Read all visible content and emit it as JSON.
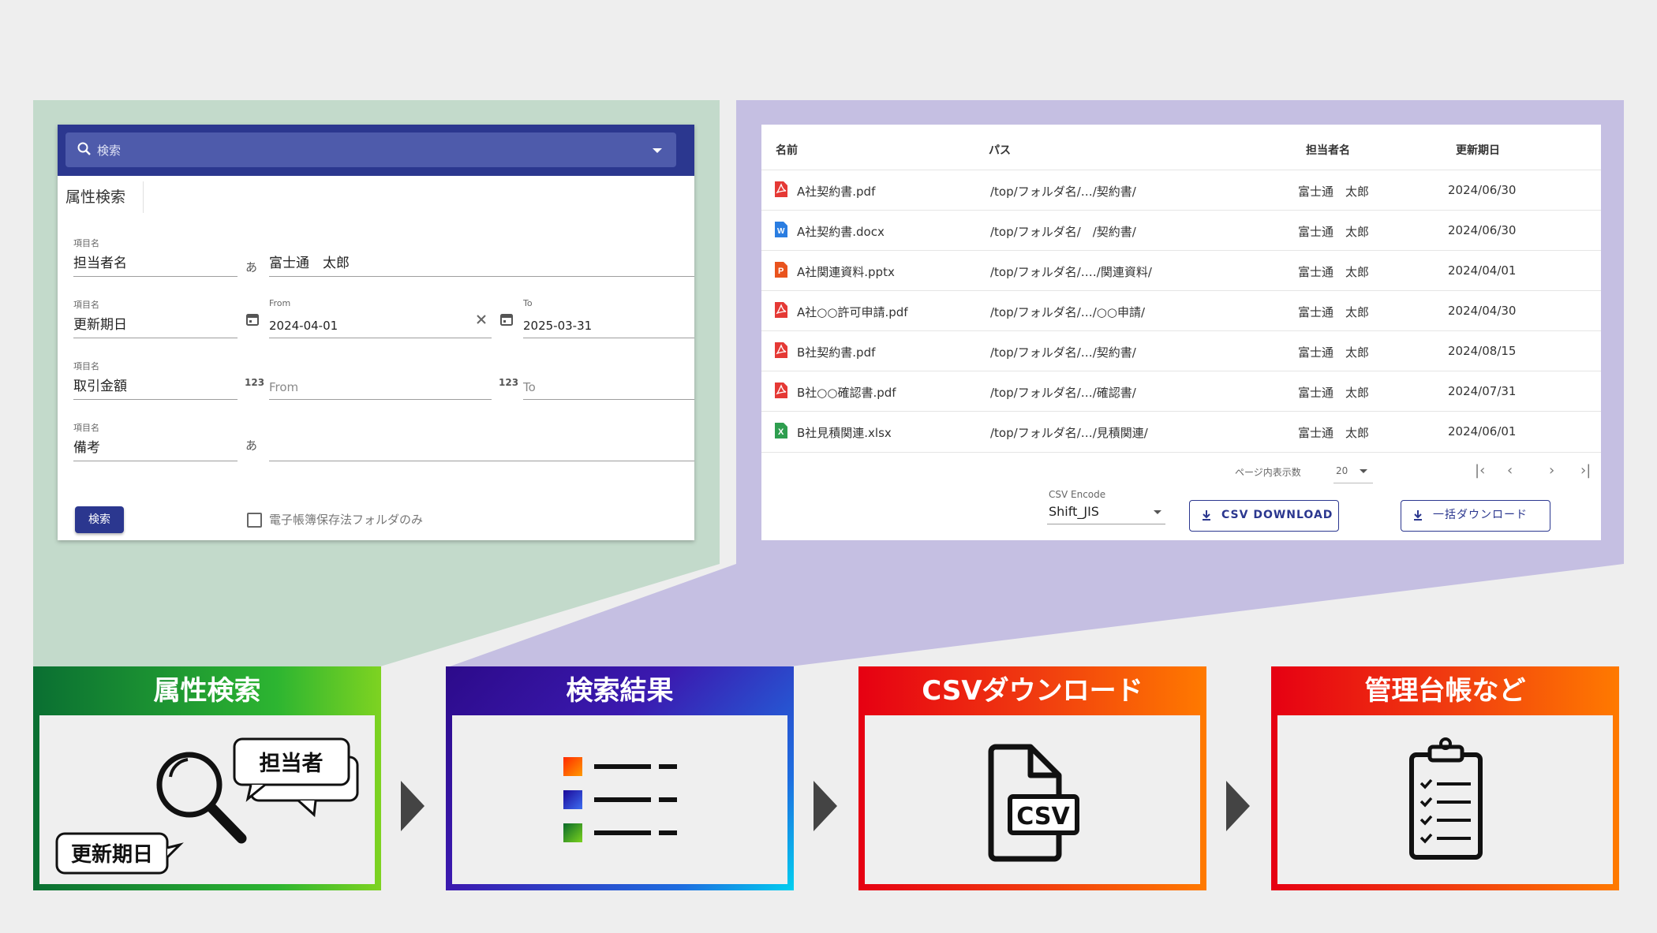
{
  "search": {
    "placeholder": "検索",
    "tab_label": "属性検索",
    "fields": [
      {
        "label": "項目名",
        "name": "担当者名",
        "prefix": "あ",
        "value": "富士通　太郎"
      },
      {
        "label": "項目名",
        "name": "更新期日",
        "from_label": "From",
        "from_value": "2024-04-01",
        "to_label": "To",
        "to_value": "2025-03-31"
      },
      {
        "label": "項目名",
        "name": "取引金額",
        "prefix": "123",
        "from_placeholder": "From",
        "to_placeholder": "To"
      },
      {
        "label": "項目名",
        "name": "備考",
        "prefix": "あ",
        "value": ""
      }
    ],
    "search_button": "検索",
    "checkbox_label": "電子帳簿保存法フォルダのみ"
  },
  "results": {
    "headers": [
      "名前",
      "パス",
      "担当者名",
      "更新期日"
    ],
    "rows": [
      {
        "icon": "pdf-icon",
        "name": "A社契約書.pdf",
        "path": "/top/フォルダ名/…/契約書/",
        "owner": "富士通　太郎",
        "date": "2024/06/30"
      },
      {
        "icon": "word-icon",
        "name": "A社契約書.docx",
        "path": "/top/フォルダ名/　/契約書/",
        "owner": "富士通　太郎",
        "date": "2024/06/30"
      },
      {
        "icon": "powerpoint-icon",
        "name": "A社関連資料.pptx",
        "path": "/top/フォルダ名/‥‥/関連資料/",
        "owner": "富士通　太郎",
        "date": "2024/04/01"
      },
      {
        "icon": "pdf-icon",
        "name": "A社○○許可申請.pdf",
        "path": "/top/フォルダ名/…/○○申請/",
        "owner": "富士通　太郎",
        "date": "2024/04/30"
      },
      {
        "icon": "pdf-icon",
        "name": "B社契約書.pdf",
        "path": "/top/フォルダ名/…/契約書/",
        "owner": "富士通　太郎",
        "date": "2024/08/15"
      },
      {
        "icon": "pdf-icon",
        "name": "B社○○確認書.pdf",
        "path": "/top/フォルダ名/…/確認書/",
        "owner": "富士通　太郎",
        "date": "2024/07/31"
      },
      {
        "icon": "excel-icon",
        "name": "B社見積関連.xlsx",
        "path": "/top/フォルダ名/…/見積関連/",
        "owner": "富士通　太郎",
        "date": "2024/06/01"
      }
    ],
    "rows_per_page_label": "ページ内表示数",
    "rows_per_page": "20",
    "csv_encode_label": "CSV Encode",
    "csv_encode_value": "Shift_JIS",
    "csv_download_label": "CSV DOWNLOAD",
    "bulk_download_label": "一括ダウンロード"
  },
  "flow": [
    {
      "title": "属性検索",
      "bubble1": "担当者",
      "bubble2": "更新期日"
    },
    {
      "title": "検索結果"
    },
    {
      "title": "CSVダウンロード",
      "file_text": "CSV"
    },
    {
      "title": "管理台帳など"
    }
  ],
  "colors": {
    "header_navy": "#2b378f",
    "search_field": "#4e5bab",
    "green_panel": "#c3dacb",
    "purple_panel": "#c5bfe2",
    "pdf_red": "#e53935",
    "word_blue": "#2a7de1",
    "ppt_orange": "#e9531d",
    "excel_green": "#2e9e4f"
  }
}
